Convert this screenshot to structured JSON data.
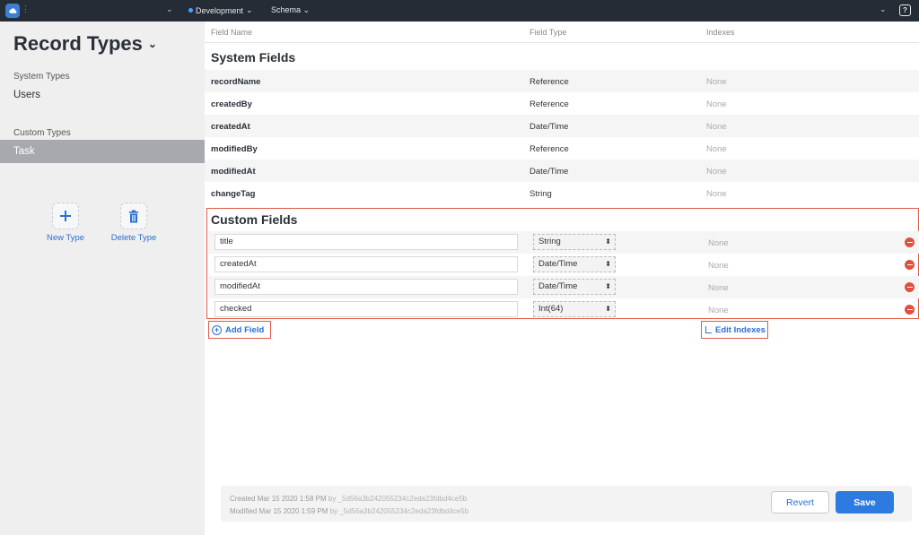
{
  "topbar": {
    "environment": "Development",
    "schema": "Schema",
    "help": "?"
  },
  "sidebar": {
    "title": "Record Types",
    "system_types_label": "System Types",
    "system_types": [
      {
        "label": "Users"
      }
    ],
    "custom_types_label": "Custom Types",
    "custom_types": [
      {
        "label": "Task",
        "selected": true
      }
    ],
    "new_type_label": "New Type",
    "delete_type_label": "Delete Type"
  },
  "table": {
    "headers": {
      "name": "Field Name",
      "type": "Field Type",
      "indexes": "Indexes"
    },
    "system_heading": "System Fields",
    "system_fields": [
      {
        "name": "recordName",
        "type": "Reference",
        "indexes": "None"
      },
      {
        "name": "createdBy",
        "type": "Reference",
        "indexes": "None"
      },
      {
        "name": "createdAt",
        "type": "Date/Time",
        "indexes": "None"
      },
      {
        "name": "modifiedBy",
        "type": "Reference",
        "indexes": "None"
      },
      {
        "name": "modifiedAt",
        "type": "Date/Time",
        "indexes": "None"
      },
      {
        "name": "changeTag",
        "type": "String",
        "indexes": "None"
      }
    ],
    "custom_heading": "Custom Fields",
    "custom_fields": [
      {
        "name": "title",
        "type": "String",
        "indexes": "None"
      },
      {
        "name": "createdAt",
        "type": "Date/Time",
        "indexes": "None"
      },
      {
        "name": "modifiedAt",
        "type": "Date/Time",
        "indexes": "None"
      },
      {
        "name": "checked",
        "type": "Int(64)",
        "indexes": "None"
      }
    ],
    "add_field_label": "Add Field",
    "edit_indexes_label": "Edit Indexes"
  },
  "footer": {
    "created_label": "Created",
    "created_date": "Mar 15 2020 1:58 PM",
    "created_by": "by _5d56a3b242055234c2eda23fdbd4ce5b",
    "modified_label": "Modified",
    "modified_date": "Mar 15 2020 1:59 PM",
    "modified_by": "by _5d56a3b242055234c2eda23fdbd4ce5b",
    "revert_label": "Revert",
    "save_label": "Save"
  },
  "colors": {
    "accent": "#2d7be0",
    "highlight_border": "#e05a48",
    "remove": "#e0503e",
    "topbar": "#262c36"
  }
}
